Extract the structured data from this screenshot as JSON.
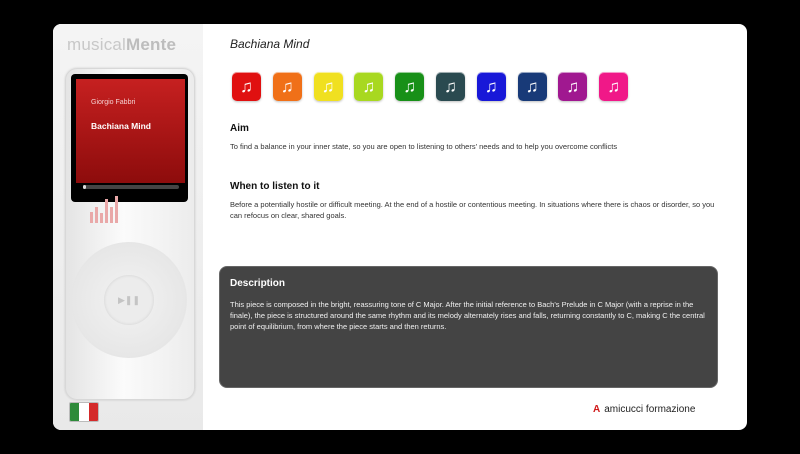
{
  "app": {
    "logo_light": "musical",
    "logo_bold": "Mente"
  },
  "player": {
    "artist": "Giorgio Fabbri",
    "song": "Bachiana Mind",
    "progress": 0.02,
    "eq_levels": [
      0.35,
      0.5,
      0.3,
      0.75,
      0.5,
      0.85
    ],
    "play_pause_glyph": "▶❚❚"
  },
  "page": {
    "title": "Bachiana Mind"
  },
  "tracks": [
    {
      "icon": "music-note-icon",
      "color": "#e01010"
    },
    {
      "icon": "music-note-icon",
      "color": "#f07018"
    },
    {
      "icon": "music-note-icon",
      "color": "#f0e020"
    },
    {
      "icon": "music-note-icon",
      "color": "#a8d820"
    },
    {
      "icon": "music-note-icon",
      "color": "#189018"
    },
    {
      "icon": "music-note-icon",
      "color": "#2a4a50"
    },
    {
      "icon": "music-note-icon",
      "color": "#1818d8"
    },
    {
      "icon": "music-note-icon",
      "color": "#183a78"
    },
    {
      "icon": "music-note-icon",
      "color": "#a01890"
    },
    {
      "icon": "music-note-icon",
      "color": "#f01888"
    }
  ],
  "note_glyph": "♫",
  "aim": {
    "heading": "Aim",
    "text": "To find a balance in your inner state, so you are open to listening to others' needs and to help you overcome conflicts"
  },
  "when": {
    "heading": "When to listen to it",
    "text": "Before a potentially hostile or difficult meeting. At the end of a hostile or contentious meeting. In situations where there is chaos or disorder, so you can refocus on clear, shared goals."
  },
  "description": {
    "heading": "Description",
    "text": "This piece is composed in the bright, reassuring tone of C Major. After the initial reference to Bach's Prelude in C Major (with a reprise in the finale), the piece is structured around the same rhythm and its melody alternately rises and falls, returning constantly to C, making C the central point of equilibrium, from where the piece starts and then returns."
  },
  "language_flag": {
    "icon": "italy-flag-icon",
    "colors": [
      "#2e8b3a",
      "#ffffff",
      "#d42a2a"
    ]
  },
  "brand": {
    "mark": "A",
    "name": "amicucci formazione"
  }
}
